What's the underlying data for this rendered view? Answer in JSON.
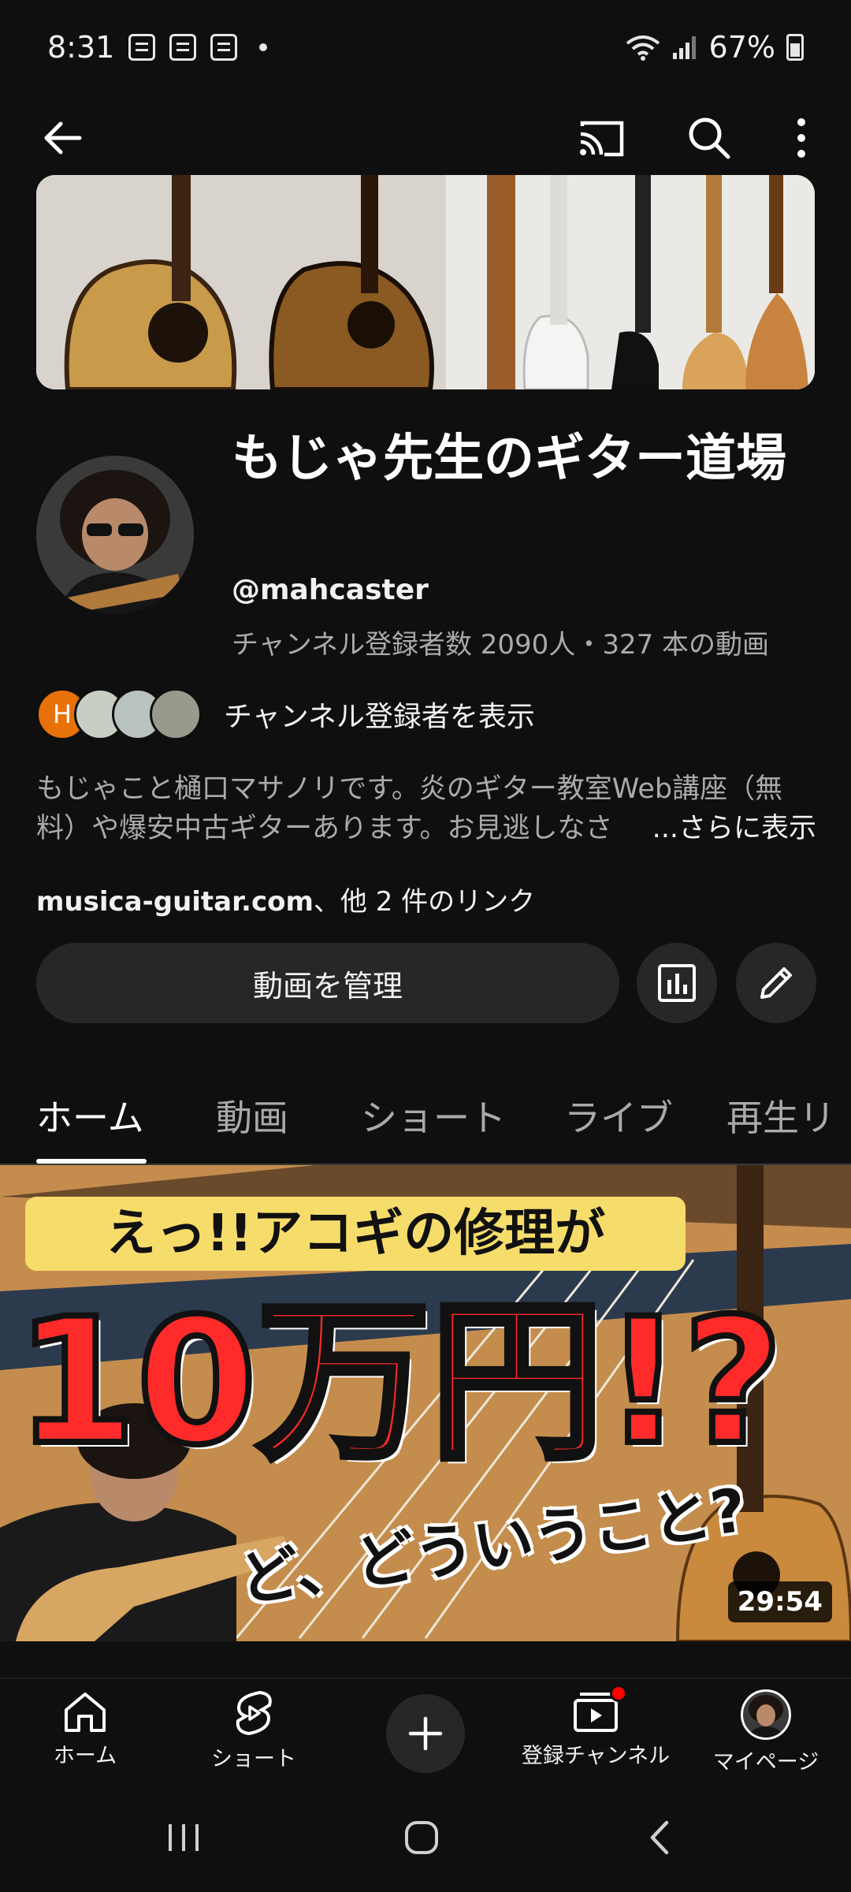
{
  "status_bar": {
    "time": "8:31",
    "battery": "67%"
  },
  "channel": {
    "title": "もじゃ先生のギター道場",
    "handle": "@mahcaster",
    "meta": "チャンネル登録者数 2090人・327 本の動画",
    "subscribers_label": "チャンネル登録者を表示",
    "subscriber_initial": "H",
    "description": "もじゃこと樋口マサノリです。炎のギター教室Web講座（無料）や爆安中古ギターあります。お見逃しなさ",
    "more_label": "...さらに表示",
    "links_domain": "musica-guitar.com",
    "links_suffix": "、他 2 件のリンク",
    "manage_label": "動画を管理"
  },
  "tabs": [
    {
      "label": "ホーム",
      "active": true
    },
    {
      "label": "動画"
    },
    {
      "label": "ショート"
    },
    {
      "label": "ライブ"
    },
    {
      "label": "再生リ"
    }
  ],
  "video": {
    "caption_top": "えっ!!アコギの修理が",
    "caption_big": "10万円!?",
    "caption_hand": "ど、どういうこと?",
    "duration": "29:54"
  },
  "bottom_nav": {
    "home": "ホーム",
    "shorts": "ショート",
    "subscriptions": "登録チャンネル",
    "you": "マイページ"
  },
  "colors": {
    "background": "#0f0f0f",
    "surface": "#272727",
    "accent_red": "#ff0000",
    "avatar_orange": "#e8710a"
  }
}
